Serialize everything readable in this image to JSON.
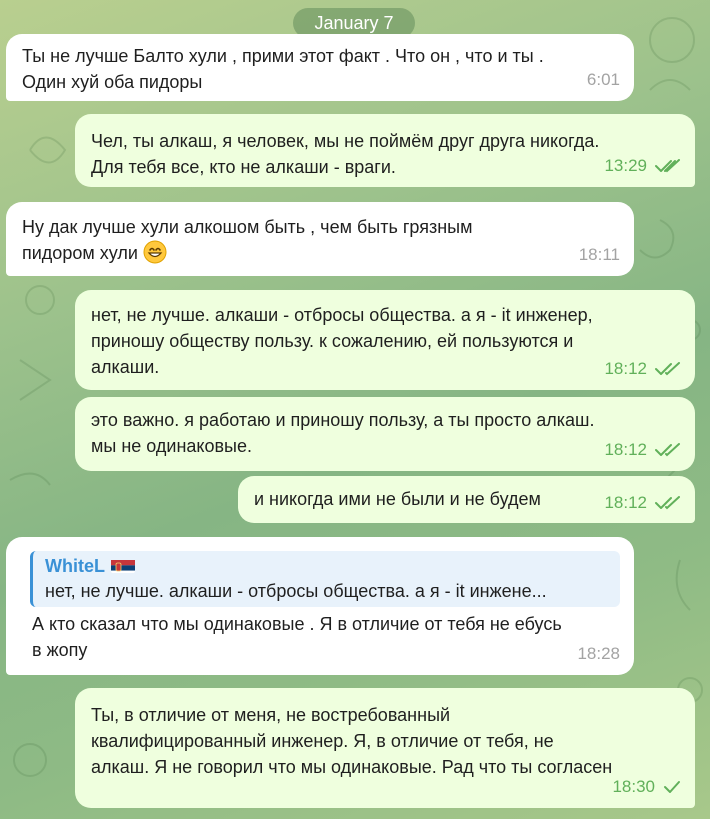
{
  "date_label": "January 7",
  "messages": [
    {
      "id": "m1",
      "direction": "in",
      "lines": [
        "Ты не лучше Балто хули , прими этот факт . Что он , что и ты .",
        "Один хуй оба пидоры"
      ],
      "time": "6:01"
    },
    {
      "id": "m2",
      "direction": "out",
      "lines": [
        "Чел, ты алкаш, я человек, мы не поймём друг друга никогда.",
        "Для тебя все, кто не алкаши - враги."
      ],
      "time": "13:29",
      "status": "read"
    },
    {
      "id": "m3",
      "direction": "in",
      "lines": [
        "Ну дак лучше хули алкошом быть , чем быть грязным",
        "пидором хули"
      ],
      "emoji": "grinning-face-emoji",
      "time": "18:11"
    },
    {
      "id": "m4",
      "direction": "out",
      "lines": [
        "нет, не лучше. алкаши - отбросы общества. а я - it инженер,",
        "приношу обществу пользу. к сожалению, ей пользуются и",
        "алкаши."
      ],
      "time": "18:12",
      "status": "read"
    },
    {
      "id": "m5",
      "direction": "out",
      "lines": [
        "это важно. я работаю и приношу пользу, а ты просто алкаш.",
        "мы не одинаковые."
      ],
      "time": "18:12",
      "status": "read"
    },
    {
      "id": "m6",
      "direction": "out",
      "lines": [
        "и никогда ими не были и не будем"
      ],
      "time": "18:12",
      "status": "read"
    },
    {
      "id": "m7",
      "direction": "in",
      "reply": {
        "name": "WhiteL",
        "flag": "serbia-flag",
        "text": "нет, не лучше. алкаши - отбросы общества. а я - it инжене..."
      },
      "lines": [
        "А кто сказал что мы одинаковые . Я в отличие от тебя не ебусь",
        "в жопу"
      ],
      "time": "18:28"
    },
    {
      "id": "m8",
      "direction": "out",
      "lines": [
        "Ты, в отличие от меня, не востребованный",
        "квалифицированный инженер. Я, в отличие от тебя, не",
        "алкаш. Я не говорил что мы одинаковые. Рад что ты согласен"
      ],
      "time": "18:30",
      "status": "sent"
    }
  ],
  "colors": {
    "incoming_bubble": "#ffffff",
    "outgoing_bubble": "#efffde",
    "outgoing_meta": "#61b05a",
    "incoming_meta": "#a3a3a3",
    "reply_accent": "#3a91d6"
  }
}
